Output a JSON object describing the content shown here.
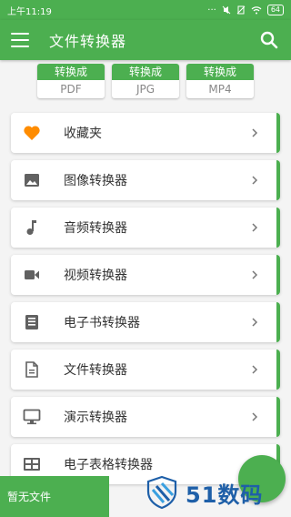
{
  "status_bar": {
    "time": "上午11:19",
    "battery": "64"
  },
  "app": {
    "title": "文件转换器"
  },
  "convert_buttons": [
    {
      "top": "转换成",
      "format": "PDF"
    },
    {
      "top": "转换成",
      "format": "JPG"
    },
    {
      "top": "转换成",
      "format": "MP4"
    }
  ],
  "menu": [
    {
      "label": "收藏夹",
      "icon": "heart-icon"
    },
    {
      "label": "图像转换器",
      "icon": "image-icon"
    },
    {
      "label": "音频转换器",
      "icon": "music-note-icon"
    },
    {
      "label": "视频转换器",
      "icon": "video-camera-icon"
    },
    {
      "label": "电子书转换器",
      "icon": "book-icon"
    },
    {
      "label": "文件转换器",
      "icon": "document-icon"
    },
    {
      "label": "演示转换器",
      "icon": "monitor-icon"
    },
    {
      "label": "电子表格转换器",
      "icon": "table-icon"
    }
  ],
  "toast": {
    "text": "暂无文件"
  },
  "watermark": {
    "text": "51数码"
  },
  "colors": {
    "accent": "#4caf50",
    "icon_gray": "#616161",
    "heart": "#ff8c00",
    "watermark": "#1e5fa8"
  }
}
